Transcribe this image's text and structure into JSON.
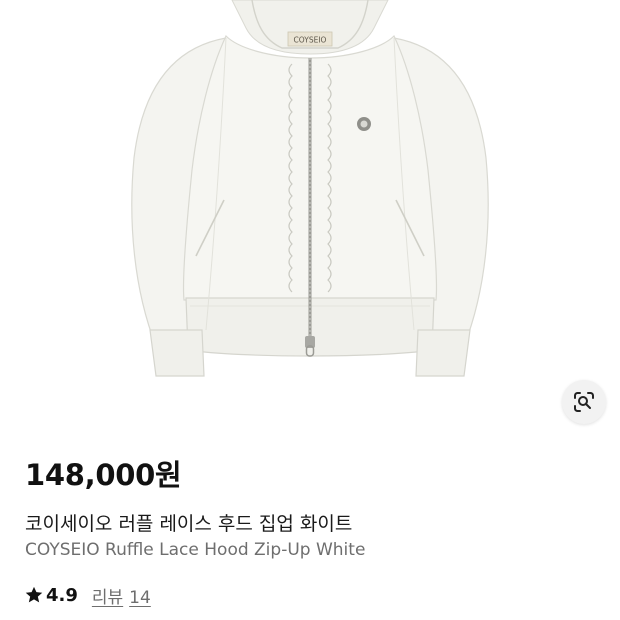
{
  "product": {
    "brand_tag": "COYSEIO",
    "price": "148,000원",
    "name_ko": "코이세이오 러플 레이스 후드 집업 화이트",
    "name_en": "COYSEIO Ruffle Lace Hood Zip-Up White",
    "rating": "4.9",
    "review_label": "리뷰",
    "review_count": "14"
  },
  "icons": {
    "visual_search": "camera-search-icon",
    "rating": "star-icon"
  },
  "colors": {
    "garment": "#f4f4f0",
    "text_primary": "#111111",
    "text_secondary": "#6e6e6e",
    "button_bg": "#f2f2f2"
  }
}
